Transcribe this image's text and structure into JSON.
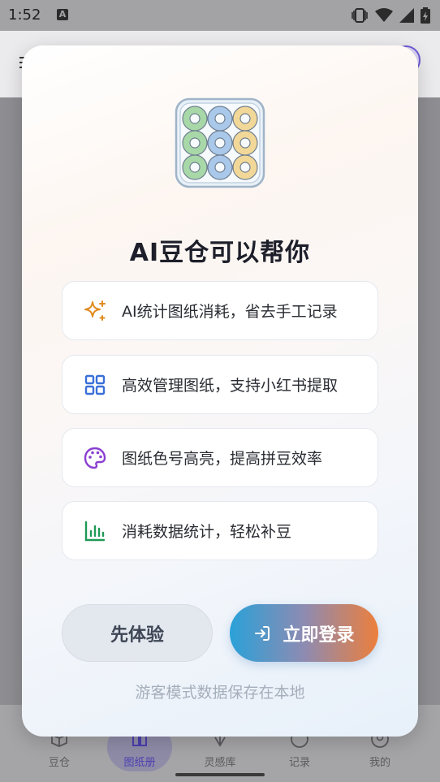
{
  "status_bar": {
    "time": "1:52",
    "notification_letter": "A"
  },
  "nav": {
    "items": [
      {
        "label": "豆仓",
        "icon": "box-icon"
      },
      {
        "label": "图纸册",
        "icon": "book-icon"
      },
      {
        "label": "灵感库",
        "icon": "sparkle-icon"
      },
      {
        "label": "记录",
        "icon": "clock-icon"
      },
      {
        "label": "我的",
        "icon": "user-icon"
      }
    ],
    "active_index": 1
  },
  "modal": {
    "title": "AI豆仓可以帮你",
    "features": [
      {
        "icon": "sparkles-icon",
        "text": "AI统计图纸消耗，省去手工记录",
        "color": "#e08a1e"
      },
      {
        "icon": "grid-icon",
        "text": "高效管理图纸，支持小红书提取",
        "color": "#3a6fd8"
      },
      {
        "icon": "palette-icon",
        "text": "图纸色号高亮，提高拼豆效率",
        "color": "#8a3fd1"
      },
      {
        "icon": "bar-chart-icon",
        "text": "消耗数据统计，轻松补豆",
        "color": "#1f9a55"
      }
    ],
    "guest_button": "先体验",
    "login_button": "立即登录",
    "footer_note": "游客模式数据保存在本地"
  }
}
